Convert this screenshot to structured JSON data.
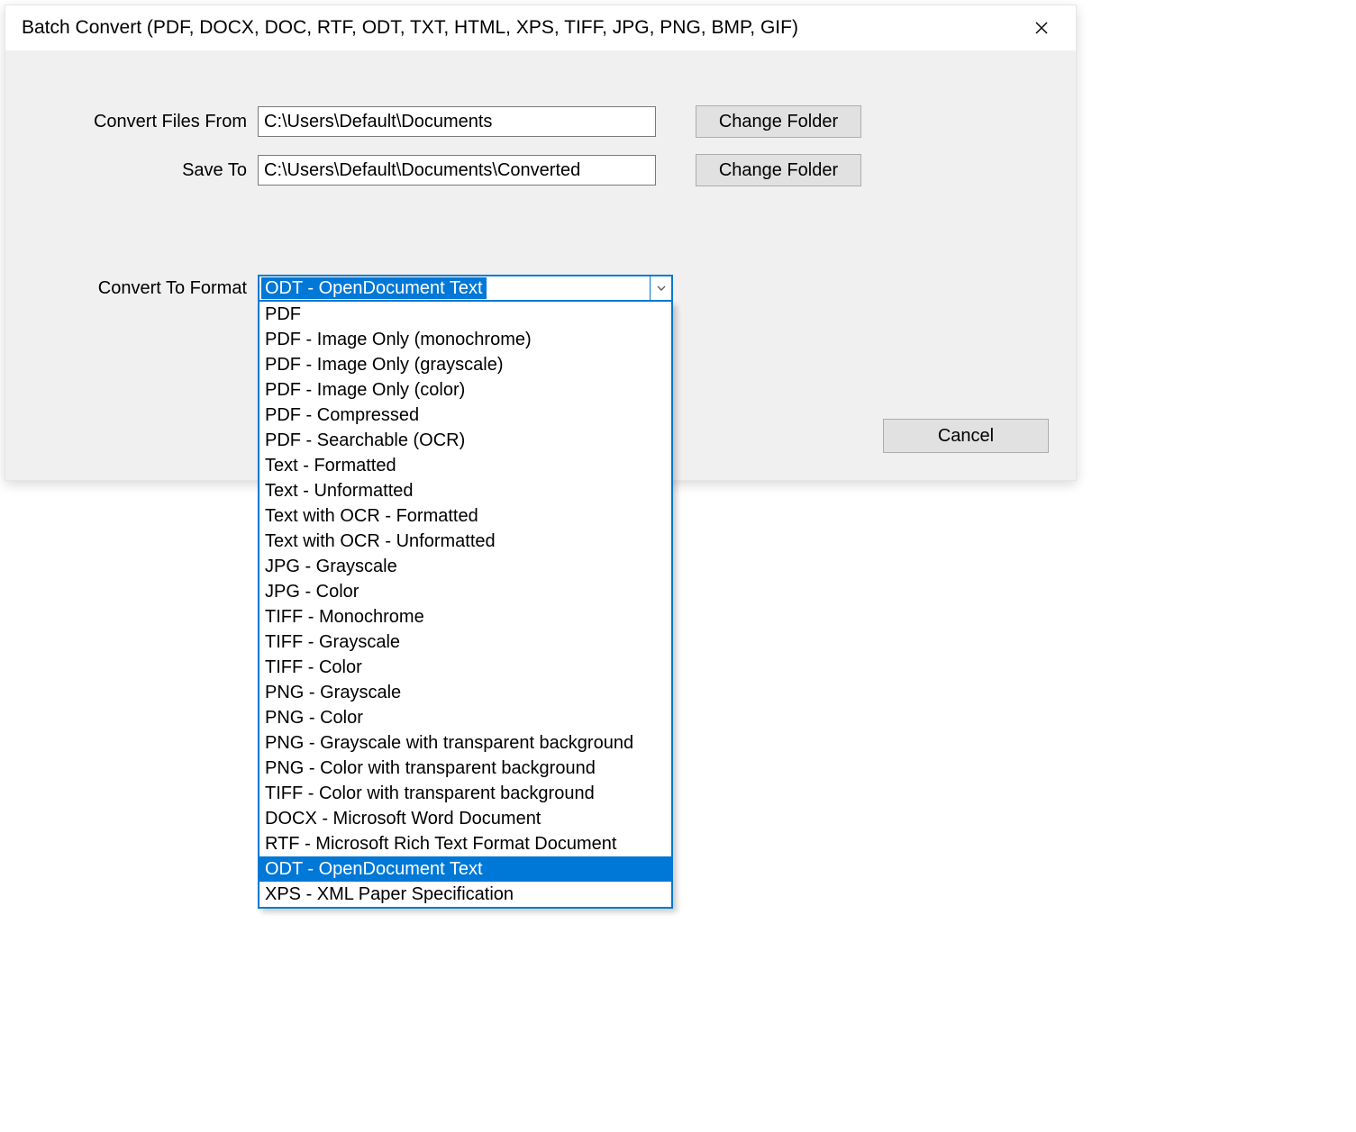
{
  "dialog": {
    "title": "Batch Convert (PDF, DOCX, DOC, RTF, ODT, TXT, HTML, XPS, TIFF, JPG, PNG, BMP, GIF)"
  },
  "labels": {
    "convert_from": "Convert Files From",
    "save_to": "Save To",
    "convert_to_format": "Convert To Format"
  },
  "inputs": {
    "from_path": "C:\\Users\\Default\\Documents",
    "to_path": "C:\\Users\\Default\\Documents\\Converted"
  },
  "buttons": {
    "change_folder": "Change Folder",
    "cancel": "Cancel"
  },
  "combo": {
    "selected": "ODT - OpenDocument Text",
    "options": [
      "PDF",
      "PDF - Image Only (monochrome)",
      "PDF - Image Only (grayscale)",
      "PDF - Image Only (color)",
      "PDF - Compressed",
      "PDF - Searchable (OCR)",
      "Text - Formatted",
      "Text - Unformatted",
      "Text with OCR - Formatted",
      "Text with OCR - Unformatted",
      "JPG - Grayscale",
      "JPG - Color",
      "TIFF - Monochrome",
      "TIFF - Grayscale",
      "TIFF - Color",
      "PNG - Grayscale",
      "PNG - Color",
      "PNG - Grayscale with transparent background",
      "PNG - Color with transparent background",
      "TIFF - Color with transparent background",
      "DOCX - Microsoft Word Document",
      "RTF - Microsoft Rich Text Format Document",
      "ODT - OpenDocument Text",
      "XPS - XML Paper Specification"
    ]
  }
}
